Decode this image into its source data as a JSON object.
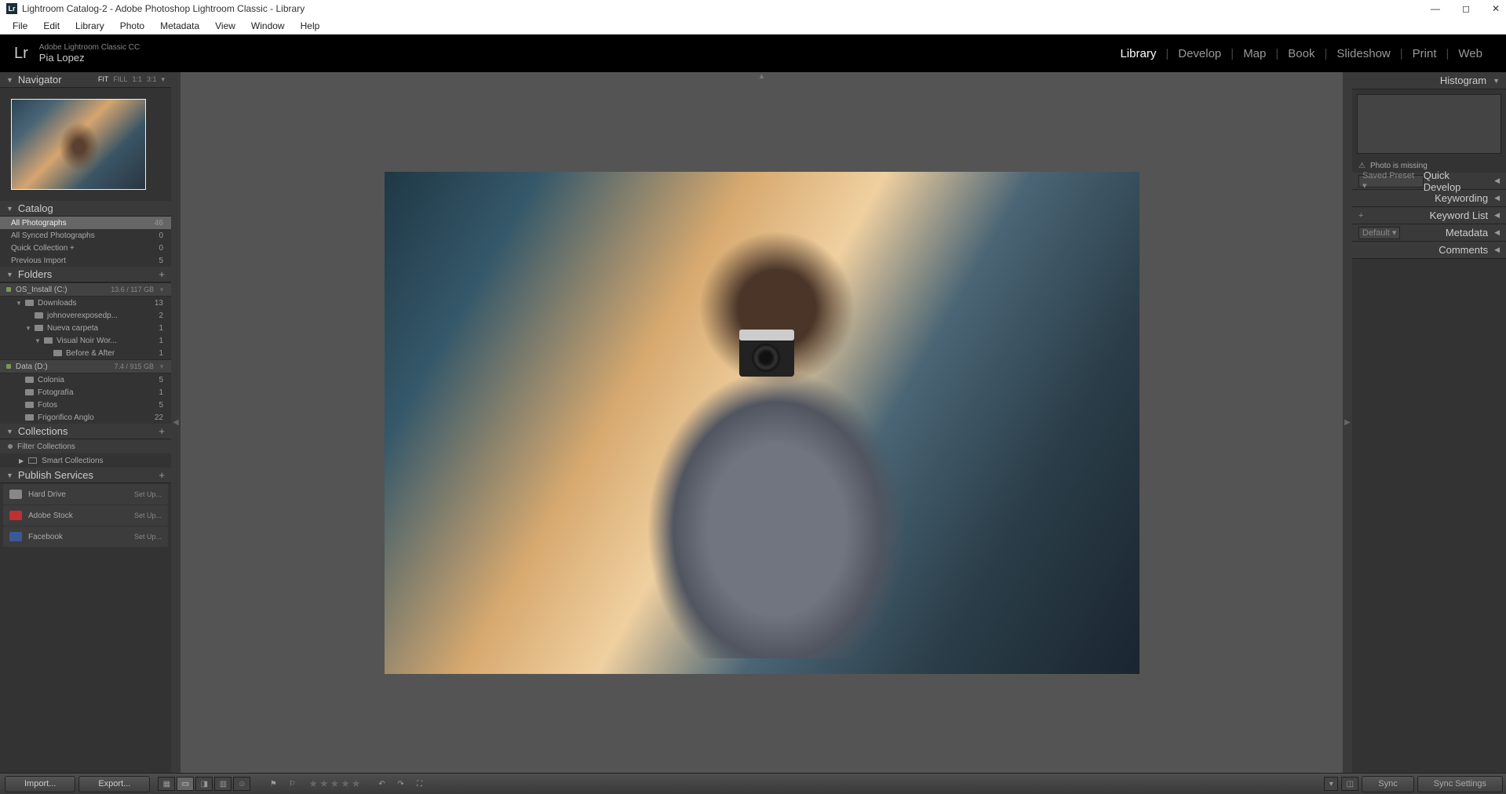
{
  "window": {
    "title": "Lightroom Catalog-2 - Adobe Photoshop Lightroom Classic - Library"
  },
  "menubar": [
    "File",
    "Edit",
    "Library",
    "Photo",
    "Metadata",
    "View",
    "Window",
    "Help"
  ],
  "header": {
    "logo": "Lr",
    "app_name": "Adobe Lightroom Classic CC",
    "user_name": "Pia Lopez",
    "modules": [
      "Library",
      "Develop",
      "Map",
      "Book",
      "Slideshow",
      "Print",
      "Web"
    ],
    "active_module": "Library"
  },
  "left": {
    "navigator": {
      "title": "Navigator",
      "zoom": [
        "FIT",
        "FILL",
        "1:1",
        "3:1"
      ],
      "zoom_active": "FIT"
    },
    "catalog": {
      "title": "Catalog",
      "items": [
        {
          "label": "All Photographs",
          "count": "46",
          "selected": true
        },
        {
          "label": "All Synced Photographs",
          "count": "0"
        },
        {
          "label": "Quick Collection  +",
          "count": "0"
        },
        {
          "label": "Previous Import",
          "count": "5"
        }
      ]
    },
    "folders": {
      "title": "Folders",
      "drives": [
        {
          "name": "OS_Install (C:)",
          "storage": "13.6 / 117 GB",
          "children": [
            {
              "label": "Downloads",
              "count": "13",
              "indent": 1,
              "expanded": true
            },
            {
              "label": "johnoverexposedp...",
              "count": "2",
              "indent": 2
            },
            {
              "label": "Nueva carpeta",
              "count": "1",
              "indent": 2,
              "expanded": true
            },
            {
              "label": "Visual Noir Wor...",
              "count": "1",
              "indent": 3,
              "expanded": true
            },
            {
              "label": "Before & After",
              "count": "1",
              "indent": 4
            }
          ]
        },
        {
          "name": "Data (D:)",
          "storage": "7.4 / 915 GB",
          "children": [
            {
              "label": "Colonia",
              "count": "5",
              "indent": 1
            },
            {
              "label": "Fotografía",
              "count": "1",
              "indent": 1
            },
            {
              "label": "Fotos",
              "count": "5",
              "indent": 1
            },
            {
              "label": "Frigorifico Anglo",
              "count": "22",
              "indent": 1
            }
          ]
        }
      ]
    },
    "collections": {
      "title": "Collections",
      "filter": "Filter Collections",
      "smart": "Smart Collections"
    },
    "publish": {
      "title": "Publish Services",
      "items": [
        {
          "label": "Hard Drive",
          "setup": "Set Up...",
          "color": "#888"
        },
        {
          "label": "Adobe Stock",
          "setup": "Set Up...",
          "color": "#c03030"
        },
        {
          "label": "Facebook",
          "setup": "Set Up...",
          "color": "#3b5998"
        }
      ]
    }
  },
  "right": {
    "histogram": {
      "title": "Histogram"
    },
    "warning": "Photo is missing",
    "sections": [
      {
        "title": "Quick Develop",
        "prefix_dropdown": "Saved Preset"
      },
      {
        "title": "Keywording"
      },
      {
        "title": "Keyword List",
        "prefix": "+"
      },
      {
        "title": "Metadata",
        "prefix_dropdown": "Default"
      },
      {
        "title": "Comments"
      }
    ]
  },
  "bottom": {
    "import": "Import...",
    "export": "Export...",
    "sync": "Sync",
    "sync_settings": "Sync Settings"
  }
}
